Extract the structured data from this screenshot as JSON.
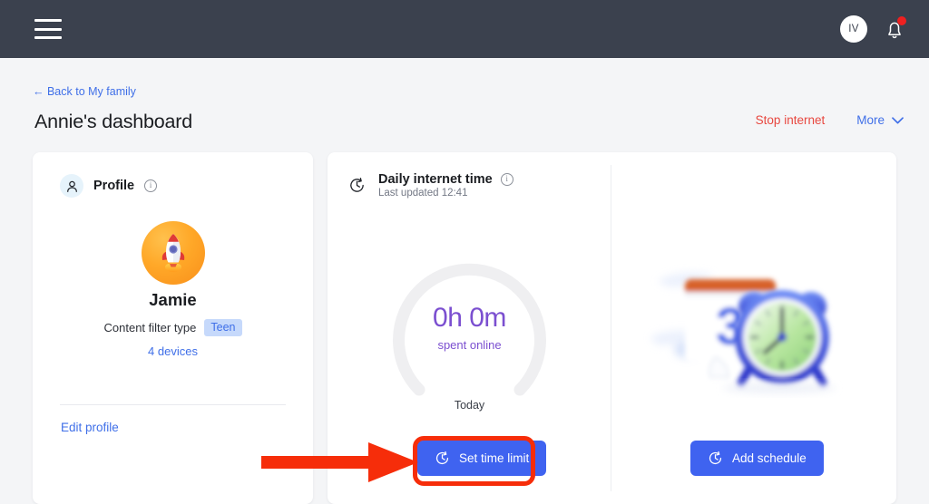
{
  "topbar": {
    "menu_icon": "hamburger-menu-icon",
    "avatar_initials": "IV",
    "bell_icon": "notification-bell-icon",
    "has_notification": true,
    "background_color": "#3b414e"
  },
  "header": {
    "back_link": "← Back to My family",
    "title": "Annie's dashboard",
    "stop_internet": "Stop internet",
    "more": "More",
    "more_icon": "chevron-down-icon",
    "stop_color": "#e8473f",
    "link_color": "#3f6fe8"
  },
  "profile_card": {
    "icon": "person-icon",
    "title": "Profile",
    "info_icon": "info-circle-icon",
    "avatar_icon": "rocket-avatar",
    "name": "Jamie",
    "filter_label": "Content filter type",
    "filter_value": "Teen",
    "devices_link": "4 devices",
    "edit_link": "Edit profile"
  },
  "time_card": {
    "icon": "clock-icon",
    "title": "Daily internet time",
    "info_icon": "info-circle-icon",
    "last_updated": "Last updated 12:41",
    "gauge_value": "0h 0m",
    "gauge_sub": "spent online",
    "gauge_period": "Today",
    "gauge_color": "#7b4fd0",
    "gauge_track_color": "#efeff1",
    "set_limit_button": "Set time limit",
    "set_limit_icon": "clock-icon",
    "schedule_illustration": "calendar-and-alarm-clock-illustration",
    "schedule_calendar_number": "3",
    "add_schedule_button": "Add schedule",
    "add_schedule_icon": "clock-icon",
    "button_color": "#3f63f0"
  },
  "annotation": {
    "arrow_icon": "red-arrow-pointer",
    "highlight_icon": "red-highlight-ring",
    "color": "#f62d0a",
    "points_at": "Set time limit"
  }
}
